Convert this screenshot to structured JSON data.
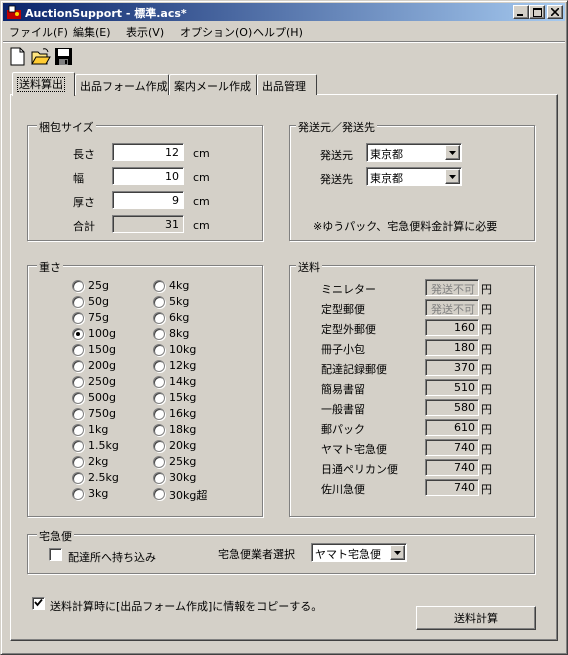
{
  "window": {
    "title": "AuctionSupport - 標準.acs*"
  },
  "menu": [
    "ファイル(F)",
    "編集(E)",
    "表示(V)",
    "オプション(O)",
    "ヘルプ(H)"
  ],
  "toolbar": {
    "icons": [
      "new-file-icon",
      "open-folder-icon",
      "save-disk-icon"
    ]
  },
  "tabs": [
    "送料算出",
    "出品フォーム作成",
    "案内メール作成",
    "出品管理"
  ],
  "package_size": {
    "title": "梱包サイズ",
    "unit": "cm",
    "rows": [
      {
        "label": "長さ",
        "value": "12"
      },
      {
        "label": "幅",
        "value": "10"
      },
      {
        "label": "厚さ",
        "value": "9"
      },
      {
        "label": "合計",
        "value": "31"
      }
    ]
  },
  "origin_destination": {
    "title": "発送元／発送先",
    "origin_label": "発送元",
    "origin_value": "東京都",
    "dest_label": "発送先",
    "dest_value": "東京都",
    "note": "※ゆうパック、宅急便料金計算に必要"
  },
  "weight": {
    "title": "重さ",
    "selected": "100g",
    "col1": [
      "25g",
      "50g",
      "75g",
      "100g",
      "150g",
      "200g",
      "250g",
      "500g",
      "750g",
      "1kg",
      "1.5kg",
      "2kg",
      "2.5kg",
      "3kg"
    ],
    "col2": [
      "4kg",
      "5kg",
      "6kg",
      "8kg",
      "10kg",
      "12kg",
      "14kg",
      "15kg",
      "16kg",
      "18kg",
      "20kg",
      "25kg",
      "30kg",
      "30kg超"
    ]
  },
  "shipping_fees": {
    "title": "送料",
    "unit": "円",
    "rows": [
      {
        "label": "ミニレター",
        "value": "発送不可",
        "disabled": true
      },
      {
        "label": "定型郵便",
        "value": "発送不可",
        "disabled": true
      },
      {
        "label": "定型外郵便",
        "value": "160"
      },
      {
        "label": "冊子小包",
        "value": "180"
      },
      {
        "label": "配達記録郵便",
        "value": "370"
      },
      {
        "label": "簡易書留",
        "value": "510"
      },
      {
        "label": "一般書留",
        "value": "580"
      },
      {
        "label": "郵パック",
        "value": "610"
      },
      {
        "label": "ヤマト宅急便",
        "value": "740"
      },
      {
        "label": "日通ペリカン便",
        "value": "740"
      },
      {
        "label": "佐川急便",
        "value": "740"
      }
    ]
  },
  "courier": {
    "title": "宅急便",
    "dropoff_label": "配達所へ持ち込み",
    "dropoff_checked": false,
    "select_label": "宅急便業者選択",
    "select_value": "ヤマト宅急便"
  },
  "copy_option": {
    "label": "送料計算時に[出品フォーム作成]に情報をコピーする。",
    "checked": true
  },
  "calc_button": "送料計算"
}
